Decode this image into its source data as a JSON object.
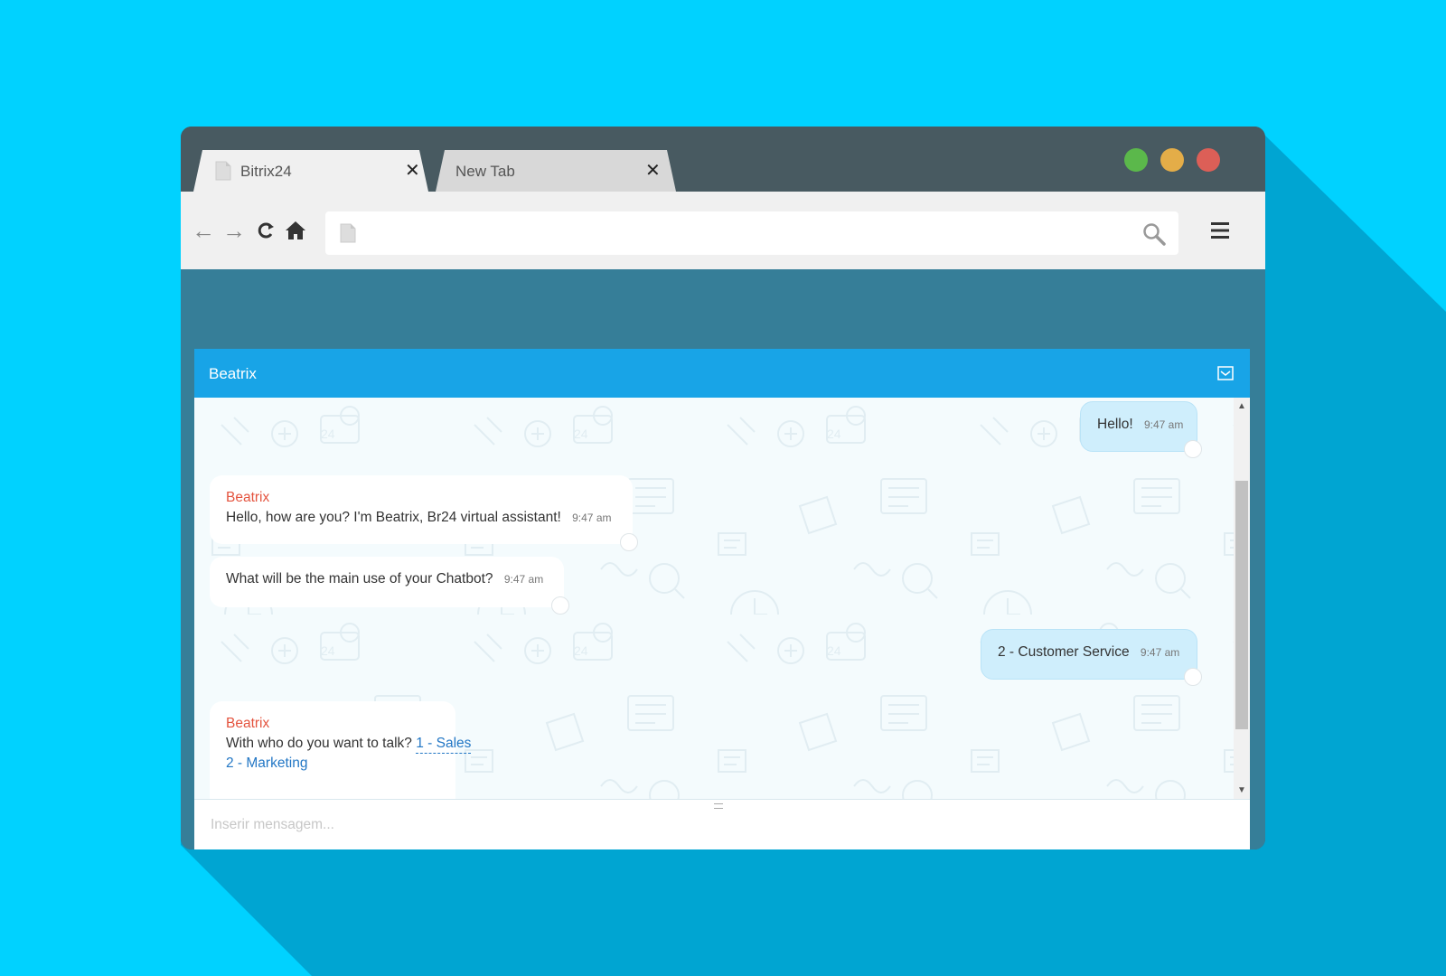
{
  "browser": {
    "tabs": [
      {
        "label": "Bitrix24",
        "active": true,
        "close_label": "✕"
      },
      {
        "label": "New Tab",
        "active": false,
        "close_label": "✕"
      }
    ],
    "window_controls": {
      "green": "#5bb84b",
      "yellow": "#e4ad48",
      "red": "#dc5f57"
    },
    "toolbar": {
      "back": "←",
      "forward": "→",
      "reload": "C",
      "url_value": ""
    }
  },
  "chat": {
    "title": "Beatrix",
    "messages": [
      {
        "dir": "out",
        "text": "Hello!",
        "time": "9:47 am"
      },
      {
        "dir": "in",
        "author": "Beatrix",
        "text": "Hello, how are you? I'm Beatrix, Br24 virtual assistant!",
        "time": "9:47 am"
      },
      {
        "dir": "in",
        "text": "What will be the main use of your Chatbot?",
        "time": "9:47 am"
      },
      {
        "dir": "out",
        "text": "2 - Customer Service",
        "time": "9:47 am"
      },
      {
        "dir": "in",
        "author": "Beatrix",
        "text": "With who do you want to talk?",
        "options": [
          "1 - Sales",
          "2 - Marketing"
        ]
      }
    ],
    "input_placeholder": "Inserir mensagem...",
    "scroll": {
      "up": "▲",
      "down": "▼"
    }
  },
  "colors": {
    "page_bg": "#00d2ff",
    "header_blue": "#18a4e7",
    "author_red": "#e4533e",
    "link_blue": "#2377c5",
    "out_bubble": "#cfeefc"
  }
}
